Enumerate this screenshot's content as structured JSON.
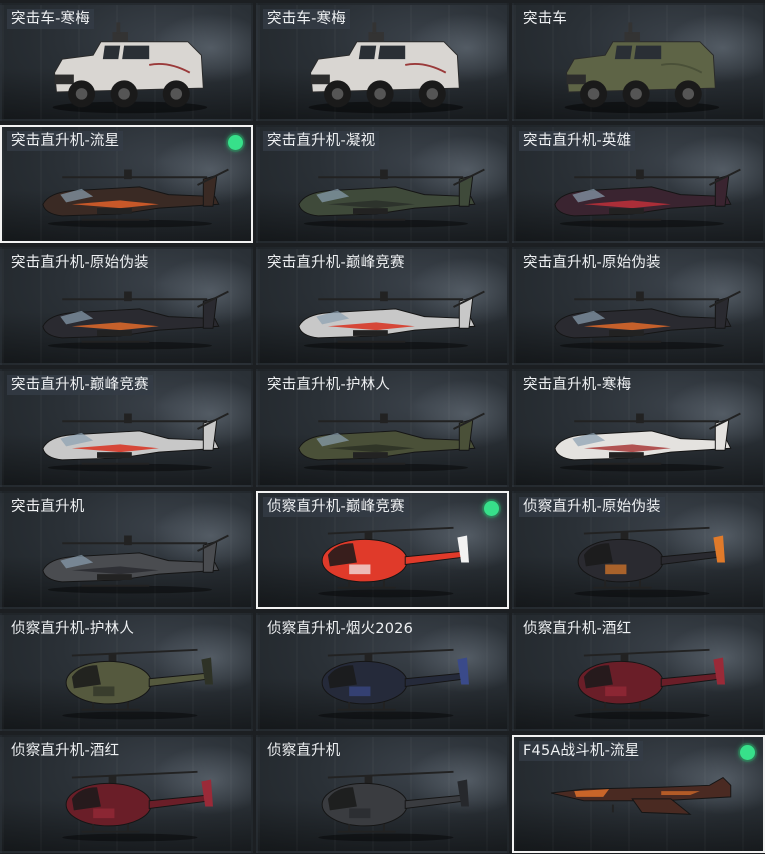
{
  "cards": [
    {
      "label": "突击车-寒梅",
      "kind": "truck",
      "color": "#d9d6d2",
      "accent": "#9a3a3a",
      "selected": false,
      "badge": false,
      "label_bg": true
    },
    {
      "label": "突击车-寒梅",
      "kind": "truck",
      "color": "#d9d6d2",
      "accent": "#9a3a3a",
      "selected": false,
      "badge": false,
      "label_bg": true
    },
    {
      "label": "突击车",
      "kind": "truck",
      "color": "#5e6446",
      "accent": "#4a5038",
      "selected": false,
      "badge": false,
      "label_bg": false
    },
    {
      "label": "突击直升机-流星",
      "kind": "attack",
      "color": "#3a2a24",
      "accent": "#e0602a",
      "selected": true,
      "badge": true,
      "label_bg": true
    },
    {
      "label": "突击直升机-凝视",
      "kind": "attack",
      "color": "#3f4a3a",
      "accent": "#2a2f2a",
      "selected": false,
      "badge": false,
      "label_bg": true
    },
    {
      "label": "突击直升机-英雄",
      "kind": "attack",
      "color": "#3a2430",
      "accent": "#c0303a",
      "selected": false,
      "badge": false,
      "label_bg": true
    },
    {
      "label": "突击直升机-原始伪装",
      "kind": "attack",
      "color": "#2a2a30",
      "accent": "#e06a2a",
      "selected": false,
      "badge": false,
      "label_bg": false
    },
    {
      "label": "突击直升机-巅峰竞赛",
      "kind": "attack",
      "color": "#c8c8c8",
      "accent": "#d8301e",
      "selected": false,
      "badge": false,
      "label_bg": false
    },
    {
      "label": "突击直升机-原始伪装",
      "kind": "attack",
      "color": "#2a2a30",
      "accent": "#e06a2a",
      "selected": false,
      "badge": false,
      "label_bg": false
    },
    {
      "label": "突击直升机-巅峰竞赛",
      "kind": "attack",
      "color": "#c8c8c8",
      "accent": "#d8301e",
      "selected": false,
      "badge": false,
      "label_bg": true
    },
    {
      "label": "突击直升机-护林人",
      "kind": "attack",
      "color": "#4a5038",
      "accent": "#2c3024",
      "selected": false,
      "badge": false,
      "label_bg": false
    },
    {
      "label": "突击直升机-寒梅",
      "kind": "attack",
      "color": "#e4e2df",
      "accent": "#a83a3a",
      "selected": false,
      "badge": false,
      "label_bg": false
    },
    {
      "label": "突击直升机",
      "kind": "attack",
      "color": "#4a4c50",
      "accent": "#2a2c30",
      "selected": false,
      "badge": false,
      "label_bg": false
    },
    {
      "label": "侦察直升机-巅峰竞赛",
      "kind": "scout",
      "color": "#e03a2a",
      "accent": "#f2f2f2",
      "selected": true,
      "badge": true,
      "label_bg": true
    },
    {
      "label": "侦察直升机-原始伪装",
      "kind": "scout",
      "color": "#2a2a30",
      "accent": "#e07a2a",
      "selected": false,
      "badge": false,
      "label_bg": true
    },
    {
      "label": "侦察直升机-护林人",
      "kind": "scout",
      "color": "#55593e",
      "accent": "#2e3226",
      "selected": false,
      "badge": false,
      "label_bg": false
    },
    {
      "label": "侦察直升机-烟火2026",
      "kind": "scout",
      "color": "#252a3a",
      "accent": "#3a4a8a",
      "selected": false,
      "badge": false,
      "label_bg": false
    },
    {
      "label": "侦察直升机-酒红",
      "kind": "scout",
      "color": "#6a1e28",
      "accent": "#9a2a38",
      "selected": false,
      "badge": false,
      "label_bg": false
    },
    {
      "label": "侦察直升机-酒红",
      "kind": "scout",
      "color": "#6a1e28",
      "accent": "#9a2a38",
      "selected": false,
      "badge": false,
      "label_bg": false
    },
    {
      "label": "侦察直升机",
      "kind": "scout",
      "color": "#3a3c40",
      "accent": "#26282c",
      "selected": false,
      "badge": false,
      "label_bg": false
    },
    {
      "label": "F45A战斗机-流星",
      "kind": "jet",
      "color": "#4a2a22",
      "accent": "#e0702a",
      "selected": true,
      "badge": true,
      "label_bg": true
    }
  ]
}
